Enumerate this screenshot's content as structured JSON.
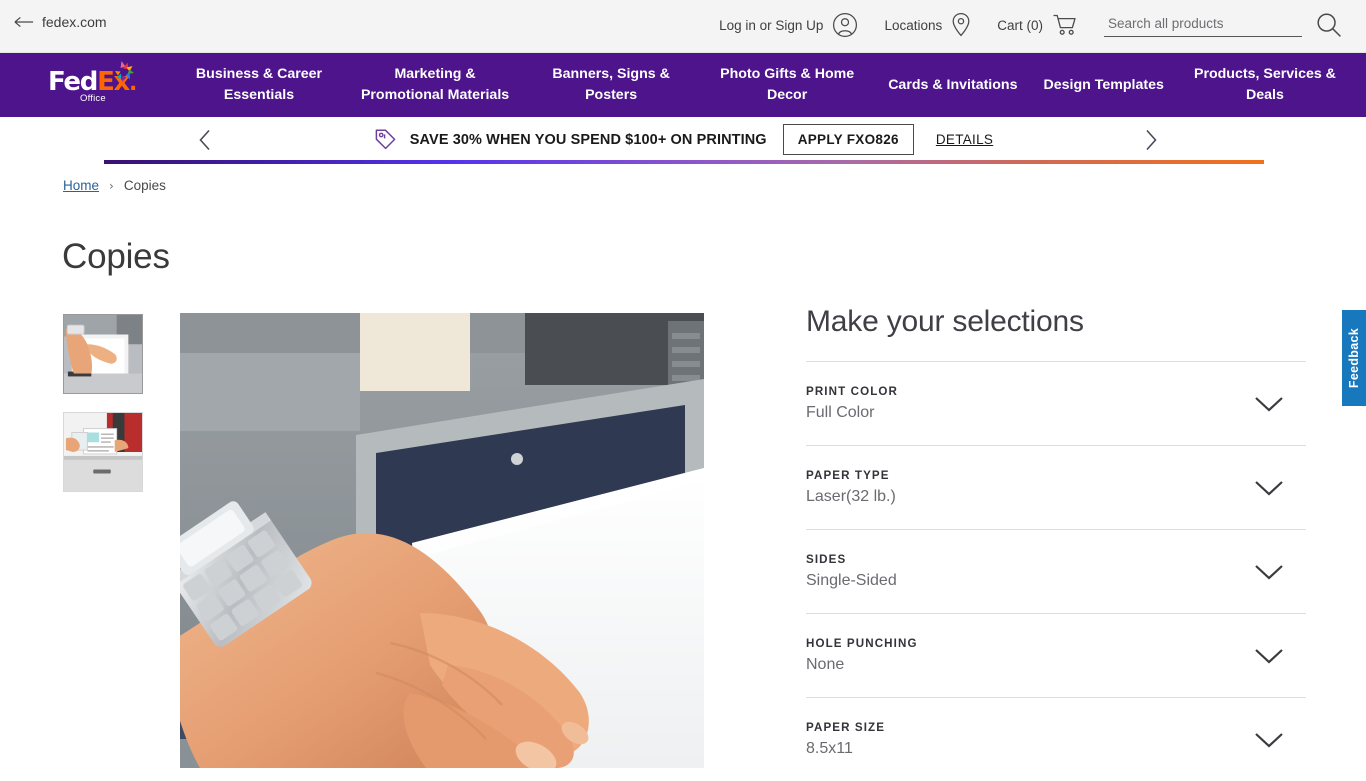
{
  "browser": {
    "back_label": "fedex.com",
    "back_icon": "back-arrow-icon"
  },
  "utility": {
    "account_label": "Log in or Sign Up",
    "account_icon": "user-circle-icon",
    "locations_label": "Locations",
    "locations_icon": "map-pin-icon",
    "cart_label": "Cart (0)",
    "cart_icon": "shopping-cart-icon",
    "search_placeholder": "Search all products",
    "search_value": "",
    "search_icon": "search-icon"
  },
  "brand": {
    "logo_fed": "Fed",
    "logo_ex": "Ex",
    "logo_dot": ".",
    "logo_sub": "Office",
    "purple": "#4d148c",
    "orange": "#ff6600"
  },
  "nav": {
    "items": [
      {
        "label": "Business & Career Essentials"
      },
      {
        "label": "Marketing & Promotional Materials"
      },
      {
        "label": "Banners, Signs & Posters"
      },
      {
        "label": "Photo Gifts & Home Decor"
      },
      {
        "label": "Cards & Invitations"
      },
      {
        "label": "Design Templates"
      },
      {
        "label": "Products, Services & Deals"
      }
    ]
  },
  "promo": {
    "prev_icon": "chevron-left-icon",
    "next_icon": "chevron-right-icon",
    "tag_icon": "price-tag-icon",
    "message": "SAVE 30% WHEN YOU SPEND $100+ ON PRINTING",
    "apply_label": "APPLY FXO826",
    "details_label": "DETAILS"
  },
  "breadcrumb": {
    "home": "Home",
    "separator": "›",
    "current": "Copies"
  },
  "page": {
    "title": "Copies"
  },
  "gallery": {
    "thumbs": [
      {
        "alt": "hand-placing-paper-on-copier-thumbnail"
      },
      {
        "alt": "person-holding-printed-documents-thumbnail"
      }
    ],
    "hero_alt": "hand-placing-paper-on-copier-glass"
  },
  "selections": {
    "heading": "Make your selections",
    "chevron_icon": "chevron-down-icon",
    "options": [
      {
        "label": "PRINT COLOR",
        "value": "Full Color"
      },
      {
        "label": "PAPER TYPE",
        "value": "Laser(32 lb.)"
      },
      {
        "label": "SIDES",
        "value": "Single-Sided"
      },
      {
        "label": "HOLE PUNCHING",
        "value": "None"
      },
      {
        "label": "PAPER SIZE",
        "value": "8.5x11"
      }
    ]
  },
  "feedback": {
    "label": "Feedback",
    "color": "#1878bd"
  }
}
